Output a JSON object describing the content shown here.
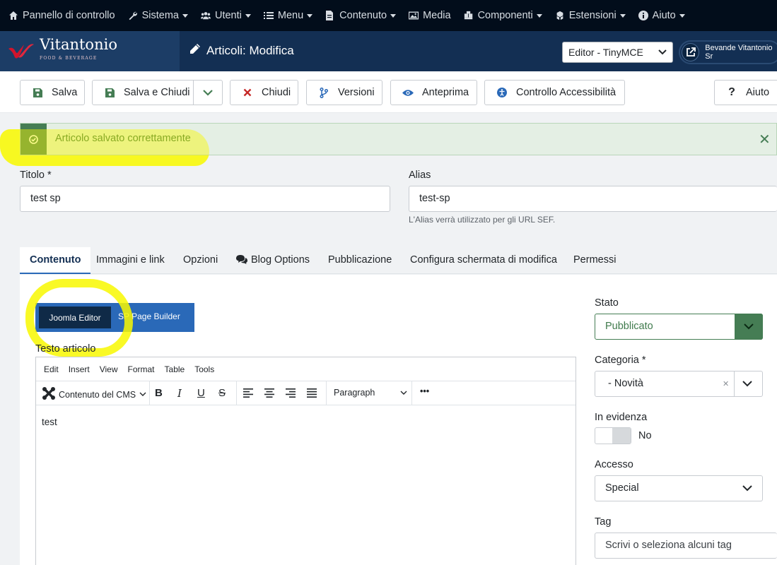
{
  "topmenu": [
    {
      "label": "Pannello di controllo",
      "icon": "home-icon",
      "caret": false
    },
    {
      "label": "Sistema",
      "icon": "wrench-icon",
      "caret": true
    },
    {
      "label": "Utenti",
      "icon": "users-icon",
      "caret": true
    },
    {
      "label": "Menu",
      "icon": "list-icon",
      "caret": true
    },
    {
      "label": "Contenuto",
      "icon": "file-icon",
      "caret": true
    },
    {
      "label": "Media",
      "icon": "image-icon",
      "caret": false
    },
    {
      "label": "Componenti",
      "icon": "puzzle-icon",
      "caret": true
    },
    {
      "label": "Estensioni",
      "icon": "cubes-icon",
      "caret": true
    },
    {
      "label": "Aiuto",
      "icon": "info-icon",
      "caret": true
    }
  ],
  "header": {
    "logo_text": "Vitantonio",
    "logo_sub": "FOOD & BEVERAGE",
    "title": "Articoli: Modifica",
    "editor_select": "Editor - TinyMCE",
    "user_label": "Bevande Vitantonio Sr"
  },
  "toolbar": {
    "save": "Salva",
    "save_close": "Salva e Chiudi",
    "close": "Chiudi",
    "versions": "Versioni",
    "preview": "Anteprima",
    "accessibility": "Controllo Accessibilità",
    "help": "Aiuto"
  },
  "alert": {
    "message": "Articolo salvato correttamente"
  },
  "form": {
    "title_label": "Titolo *",
    "title_value": "test sp",
    "alias_label": "Alias",
    "alias_value": "test-sp",
    "alias_hint": "L'Alias verrà utilizzato per gli URL SEF."
  },
  "tabs": [
    "Contenuto",
    "Immagini e link",
    "Opzioni",
    "Blog Options",
    "Pubblicazione",
    "Configura schermata di modifica",
    "Permessi"
  ],
  "editor": {
    "joomla_editor": "Joomla Editor",
    "sp_page_builder": "SP Page Builder",
    "text_label": "Testo articolo",
    "menu": [
      "Edit",
      "Insert",
      "View",
      "Format",
      "Table",
      "Tools"
    ],
    "cms_content": "Contenuto del CMS",
    "paragraph": "Paragraph",
    "more": "•••",
    "body": "test"
  },
  "side": {
    "state_label": "Stato",
    "state_value": "Pubblicato",
    "category_label": "Categoria *",
    "category_value": "- Novità",
    "featured_label": "In evidenza",
    "featured_value": "No",
    "access_label": "Accesso",
    "access_value": "Special",
    "tag_label": "Tag",
    "tag_placeholder": "Scrivi o seleziona alcuni tag"
  },
  "colors": {
    "topbar": "#020d1b",
    "header": "#132f53",
    "success": "#457d54",
    "primary": "#2a69b8",
    "highlight": "#f8f800"
  }
}
